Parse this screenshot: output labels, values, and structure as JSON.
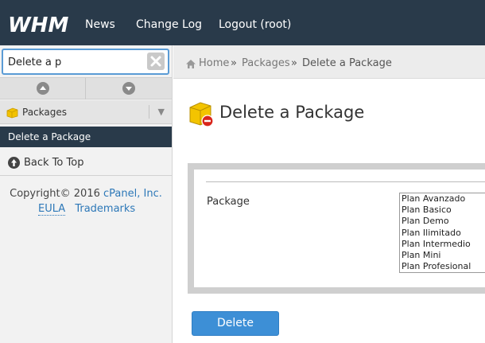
{
  "brand": {
    "logo_text": "WHM"
  },
  "topnav": {
    "news": "News",
    "changelog": "Change Log",
    "logout": "Logout (root)"
  },
  "sidebar": {
    "search_value": "Delete a p",
    "category": "Packages",
    "active_item": "Delete a Package",
    "back_to_top": "Back To Top",
    "copyright_prefix": "Copyright© 2016",
    "copyright_link": "cPanel, Inc.",
    "eula": "EULA",
    "trademarks": "Trademarks"
  },
  "breadcrumb": {
    "home": "Home",
    "sep1": "»",
    "packages": "Packages",
    "sep2": "»",
    "current": "Delete a Package"
  },
  "page": {
    "title": "Delete a Package"
  },
  "form": {
    "package_label": "Package",
    "packages": [
      "Plan Avanzado",
      "Plan Basico",
      "Plan Demo",
      "Plan Ilimitado",
      "Plan Intermedio",
      "Plan Mini",
      "Plan Profesional"
    ]
  },
  "actions": {
    "delete": "Delete"
  },
  "colors": {
    "topbar": "#293a4a",
    "accent": "#3d8fd6",
    "link": "#2d78b8"
  }
}
